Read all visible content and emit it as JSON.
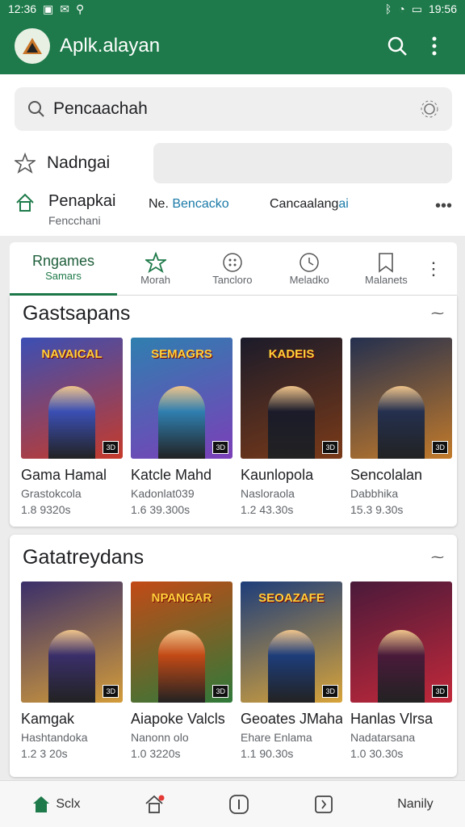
{
  "status": {
    "time": "12:36",
    "right_time": "19:56"
  },
  "app": {
    "title": "Aplk.alayan"
  },
  "search": {
    "text": "Pencaachah"
  },
  "row2": {
    "label": "Nadngai"
  },
  "row3": {
    "title": "Penapkai",
    "subtitle": "Fencchani",
    "col1_prefix": "Ne.",
    "col1_link": "Bencacko",
    "col2_text": "Cancaalang",
    "col2_link": "ai"
  },
  "tabs": [
    {
      "label": "Rngames",
      "sub": "Samars",
      "icon": "games-icon"
    },
    {
      "label": "Morah",
      "icon": "star-icon"
    },
    {
      "label": "Tancloro",
      "icon": "dots-circle-icon"
    },
    {
      "label": "Meladko",
      "icon": "clock-icon"
    },
    {
      "label": "Malanets",
      "icon": "bookmark-icon"
    }
  ],
  "section1": {
    "title": "Gastsapans",
    "games": [
      {
        "name": "Gama Hamal",
        "sub": "Grastokcola",
        "num": "1.8 9320s",
        "thumb_title": "NAVAICAL",
        "color1": "#3b4fb4",
        "color2": "#c63a2a"
      },
      {
        "name": "Katcle Mahd",
        "sub": "Kadonlat039",
        "num": "1.6 39.300s",
        "thumb_title": "SEMAGRS",
        "color1": "#2f7fb0",
        "color2": "#7b3fb8"
      },
      {
        "name": "Kaunlopola",
        "sub": "Nasloraola",
        "num": "1.2 43.30s",
        "thumb_title": "KADEIS",
        "color1": "#1b1b2a",
        "color2": "#7a3a18"
      },
      {
        "name": "Sencolalan",
        "sub": "Dabbhika",
        "num": "15.3 9.30s",
        "thumb_title": "",
        "color1": "#24304f",
        "color2": "#c27a2a"
      }
    ]
  },
  "section2": {
    "title": "Gatatreydans",
    "games": [
      {
        "name": "Kamgak",
        "sub": "Hashtandoka",
        "num": "1.2 3 20s",
        "thumb_title": "",
        "color1": "#3a2f6a",
        "color2": "#d39c3a"
      },
      {
        "name": "Aiapoke Valcls",
        "sub": "Nanonn olo",
        "num": "1.0 3220s",
        "thumb_title": "NPANGAR",
        "color1": "#c24a16",
        "color2": "#2f7a3a"
      },
      {
        "name": "Geoates JMaha",
        "sub": "Ehare Enlama",
        "num": "1.1 90.30s",
        "thumb_title": "SEOAZAFE",
        "color1": "#1d3d7a",
        "color2": "#d8a43a"
      },
      {
        "name": "Hanlas Vlrsa",
        "sub": "Nadatarsana",
        "num": "1.0 30.30s",
        "thumb_title": "",
        "color1": "#4a1a3a",
        "color2": "#c2283a"
      }
    ]
  },
  "bottom_nav": {
    "home": "Sclx",
    "right": "Nanily"
  }
}
